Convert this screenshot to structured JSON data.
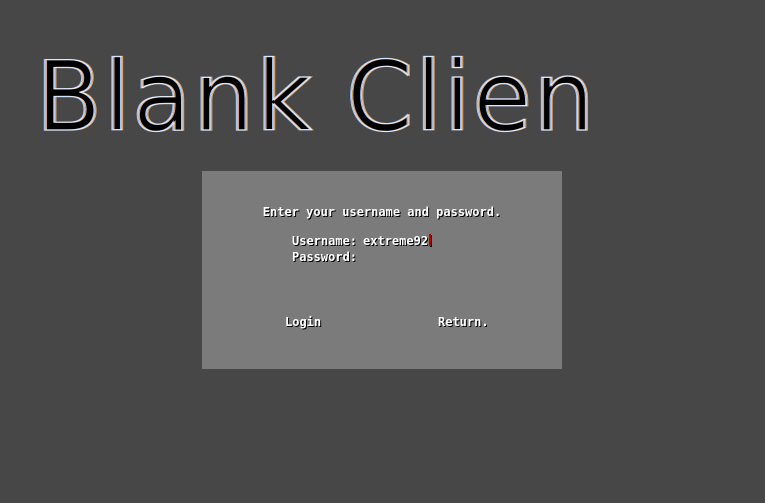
{
  "logo": {
    "text": "Blank Client"
  },
  "login": {
    "prompt": "Enter your username and password.",
    "username_label": "Username:",
    "username_value": "extreme92",
    "password_label": "Password:",
    "password_value": "",
    "login_label": "Login",
    "return_label": "Return."
  },
  "colors": {
    "background": "#474747",
    "panel": "#7b7b7b",
    "text": "#ffffff",
    "caret": "#c00000"
  }
}
